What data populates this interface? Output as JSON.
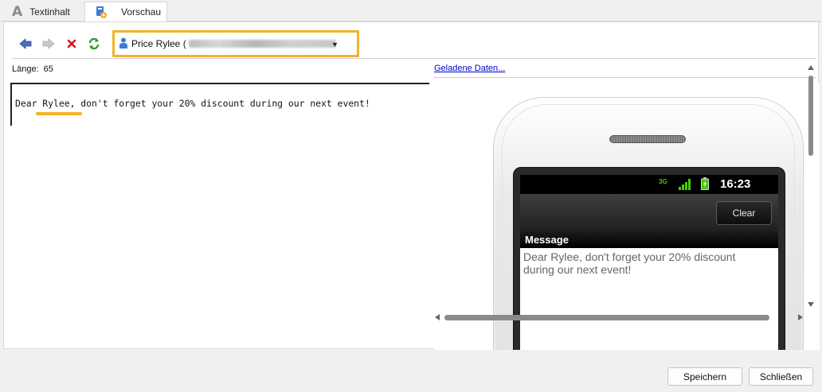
{
  "tabs": {
    "text_content": "Textinhalt",
    "preview": "Vorschau"
  },
  "toolbar": {
    "recipient_name": "Price Rylee ("
  },
  "info": {
    "length_label": "Länge:",
    "length_value": "65",
    "loaded_data_link": "Geladene Daten..."
  },
  "editor": {
    "text": "Dear Rylee, don't forget your 20% discount during our next event!"
  },
  "phone": {
    "network_label": "3G",
    "time": "16:23",
    "clear_button": "Clear",
    "message_header": "Message",
    "message_body": "Dear Rylee, don't forget your 20% discount during our next event!"
  },
  "buttons": {
    "save": "Speichern",
    "close": "Schließen"
  },
  "colors": {
    "highlight": "#f0b428",
    "link": "#0000cc",
    "signal_green": "#44d000"
  }
}
